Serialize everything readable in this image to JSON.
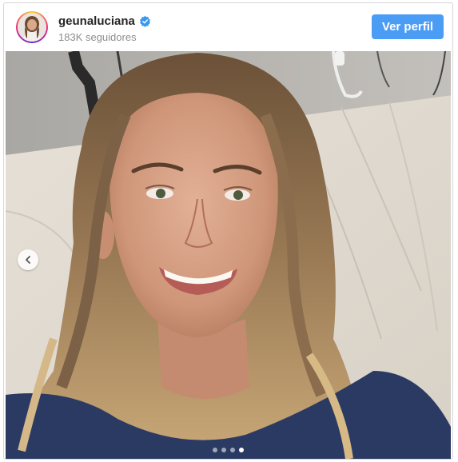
{
  "post": {
    "username": "geunaluciana",
    "followers": "183K seguidores",
    "view_profile_label": "Ver perfil",
    "verified": true
  },
  "icons": {
    "verified": "verified-badge-icon",
    "previous": "chevron-left-icon"
  },
  "carousel": {
    "total_slides": 4,
    "active_slide": 4
  },
  "colors": {
    "button": "#4a9cf5",
    "verified": "#3897f0"
  }
}
